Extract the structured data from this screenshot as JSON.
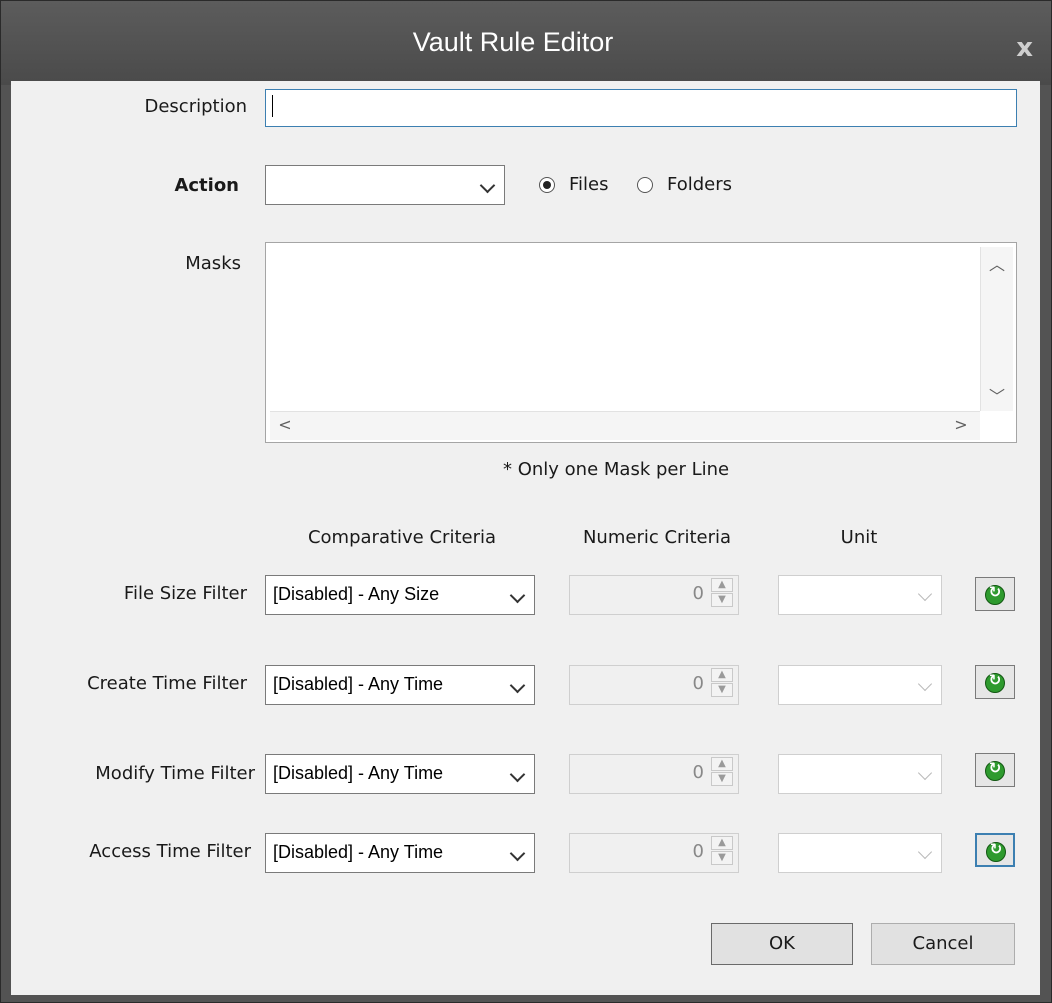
{
  "window": {
    "title": "Vault Rule Editor",
    "close_glyph": "x"
  },
  "description": {
    "label": "Description",
    "value": ""
  },
  "action": {
    "label": "Action",
    "value": "",
    "radios": {
      "files": "Files",
      "folders": "Folders",
      "selected": "files"
    }
  },
  "masks": {
    "label": "Masks",
    "value": "",
    "hint": "* Only one Mask per Line"
  },
  "columns": {
    "comparative": "Comparative Criteria",
    "numeric": "Numeric Criteria",
    "unit": "Unit"
  },
  "filters": [
    {
      "label": "File Size Filter",
      "criteria": "[Disabled] - Any Size",
      "numeric": "0",
      "unit": ""
    },
    {
      "label": "Create Time Filter",
      "criteria": "[Disabled] - Any Time",
      "numeric": "0",
      "unit": ""
    },
    {
      "label": "Modify Time Filter",
      "criteria": "[Disabled] - Any Time",
      "numeric": "0",
      "unit": ""
    },
    {
      "label": "Access Time Filter",
      "criteria": "[Disabled] - Any Time",
      "numeric": "0",
      "unit": ""
    }
  ],
  "buttons": {
    "ok": "OK",
    "cancel": "Cancel"
  },
  "colors": {
    "titlebar": "#4f4f4f",
    "client": "#f0f0f0",
    "focus": "#3c7fb1",
    "reset_icon": "#2e9a2e"
  }
}
